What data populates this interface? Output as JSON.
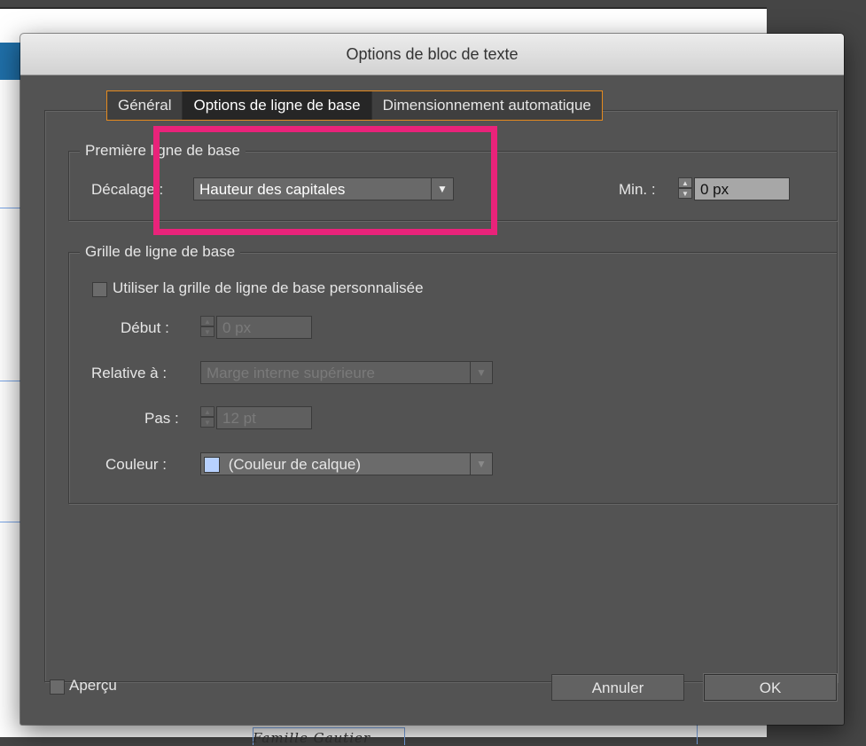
{
  "background_doc": {
    "script_text": "Famille Gautier"
  },
  "dialog": {
    "title": "Options de bloc de texte",
    "tabs": [
      {
        "label": "Général"
      },
      {
        "label": "Options de ligne de base"
      },
      {
        "label": "Dimensionnement automatique"
      }
    ],
    "first_baseline": {
      "legend": "Première ligne de base",
      "offset_label": "Décalage :",
      "offset_value": "Hauteur des capitales",
      "min_label": "Min. :",
      "min_value": "0 px"
    },
    "baseline_grid": {
      "legend": "Grille de ligne de base",
      "custom_grid_label": "Utiliser la grille de ligne de base personnalisée",
      "custom_grid_checked": false,
      "start_label": "Début :",
      "start_value": "0 px",
      "relative_label": "Relative à :",
      "relative_value": "Marge interne supérieure",
      "step_label": "Pas :",
      "step_value": "12 pt",
      "color_label": "Couleur :",
      "color_value": "(Couleur de calque)",
      "color_swatch": "#b7d1ff"
    },
    "preview_label": "Aperçu",
    "preview_checked": false,
    "cancel_label": "Annuler",
    "ok_label": "OK"
  },
  "colors": {
    "tab_focus": "#e58a1e",
    "annotation_highlight": "#e9237a",
    "dialog_bg": "#535353"
  }
}
